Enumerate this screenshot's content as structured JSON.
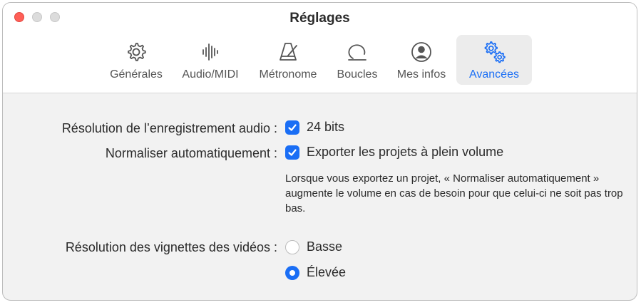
{
  "window": {
    "title": "Réglages"
  },
  "toolbar": {
    "tabs": [
      {
        "label": "Générales",
        "icon": "gear-icon"
      },
      {
        "label": "Audio/MIDI",
        "icon": "waveform-icon"
      },
      {
        "label": "Métronome",
        "icon": "metronome-icon"
      },
      {
        "label": "Boucles",
        "icon": "loop-icon"
      },
      {
        "label": "Mes infos",
        "icon": "person-circle-icon"
      },
      {
        "label": "Avancées",
        "icon": "gears-icon",
        "active": true
      }
    ]
  },
  "settings": {
    "audio_resolution": {
      "label": "Résolution de l’enregistrement audio :",
      "option": "24 bits",
      "checked": true
    },
    "normalize": {
      "label": "Normaliser automatiquement :",
      "option": "Exporter les projets à plein volume",
      "checked": true,
      "help": "Lorsque vous exportez un projet, « Normaliser automatiquement » augmente le volume en cas de besoin pour que celui-ci ne soit pas trop bas."
    },
    "video_thumbnails": {
      "label": "Résolution des vignettes des vidéos :",
      "options": [
        "Basse",
        "Élevée"
      ],
      "selected": "Élevée"
    }
  },
  "colors": {
    "accent": "#1a6ef5",
    "close": "#ff5f57"
  }
}
